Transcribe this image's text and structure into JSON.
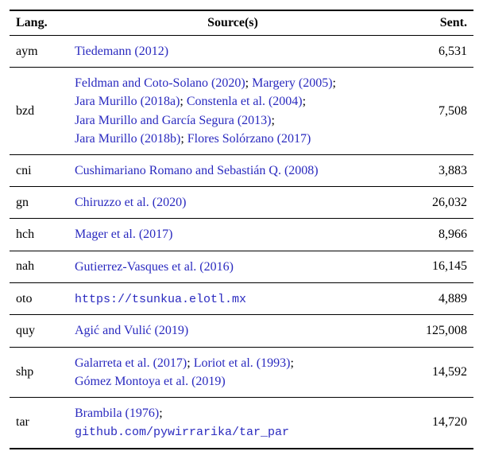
{
  "headers": {
    "lang": "Lang.",
    "sources": "Source(s)",
    "sent": "Sent."
  },
  "rows": [
    {
      "lang": "aym",
      "sources": [
        {
          "type": "cite",
          "text": "Tiedemann (2012)"
        }
      ],
      "sent": "6,531"
    },
    {
      "lang": "bzd",
      "sources": [
        {
          "type": "cite",
          "text": "Feldman and Coto-Solano (2020)"
        },
        {
          "type": "plainsep",
          "text": "; "
        },
        {
          "type": "cite",
          "text": "Margery (2005)"
        },
        {
          "type": "plainsep",
          "text": ";"
        },
        {
          "type": "br"
        },
        {
          "type": "cite",
          "text": "Jara Murillo (2018a)"
        },
        {
          "type": "plainsep",
          "text": "; "
        },
        {
          "type": "cite",
          "text": "Constenla et al. (2004)"
        },
        {
          "type": "plainsep",
          "text": ";"
        },
        {
          "type": "br"
        },
        {
          "type": "cite",
          "text": "Jara Murillo and García Segura (2013)"
        },
        {
          "type": "plainsep",
          "text": ";"
        },
        {
          "type": "br"
        },
        {
          "type": "cite",
          "text": "Jara Murillo (2018b)"
        },
        {
          "type": "plainsep",
          "text": "; "
        },
        {
          "type": "cite",
          "text": "Flores Solórzano (2017)"
        }
      ],
      "sent": "7,508"
    },
    {
      "lang": "cni",
      "sources": [
        {
          "type": "cite",
          "text": "Cushimariano Romano and Sebastián Q. (2008)"
        }
      ],
      "sent": "3,883"
    },
    {
      "lang": "gn",
      "sources": [
        {
          "type": "cite",
          "text": "Chiruzzo et al. (2020)"
        }
      ],
      "sent": "26,032"
    },
    {
      "lang": "hch",
      "sources": [
        {
          "type": "cite",
          "text": "Mager et al. (2017)"
        }
      ],
      "sent": "8,966"
    },
    {
      "lang": "nah",
      "sources": [
        {
          "type": "cite",
          "text": "Gutierrez-Vasques et al. (2016)"
        }
      ],
      "sent": "16,145"
    },
    {
      "lang": "oto",
      "sources": [
        {
          "type": "url",
          "text": "https://tsunkua.elotl.mx"
        }
      ],
      "sent": "4,889"
    },
    {
      "lang": "quy",
      "sources": [
        {
          "type": "cite",
          "text": "Agić and Vulić (2019)"
        }
      ],
      "sent": "125,008"
    },
    {
      "lang": "shp",
      "sources": [
        {
          "type": "cite",
          "text": "Galarreta et al. (2017)"
        },
        {
          "type": "plainsep",
          "text": "; "
        },
        {
          "type": "cite",
          "text": "Loriot et al. (1993)"
        },
        {
          "type": "plainsep",
          "text": ";"
        },
        {
          "type": "br"
        },
        {
          "type": "cite",
          "text": "Gómez Montoya et al. (2019)"
        }
      ],
      "sent": "14,592"
    },
    {
      "lang": "tar",
      "sources": [
        {
          "type": "cite",
          "text": "Brambila (1976)"
        },
        {
          "type": "plainsep",
          "text": ";"
        },
        {
          "type": "br"
        },
        {
          "type": "url",
          "text": "github.com/pywirrarika/tar_par"
        }
      ],
      "sent": "14,720"
    }
  ]
}
